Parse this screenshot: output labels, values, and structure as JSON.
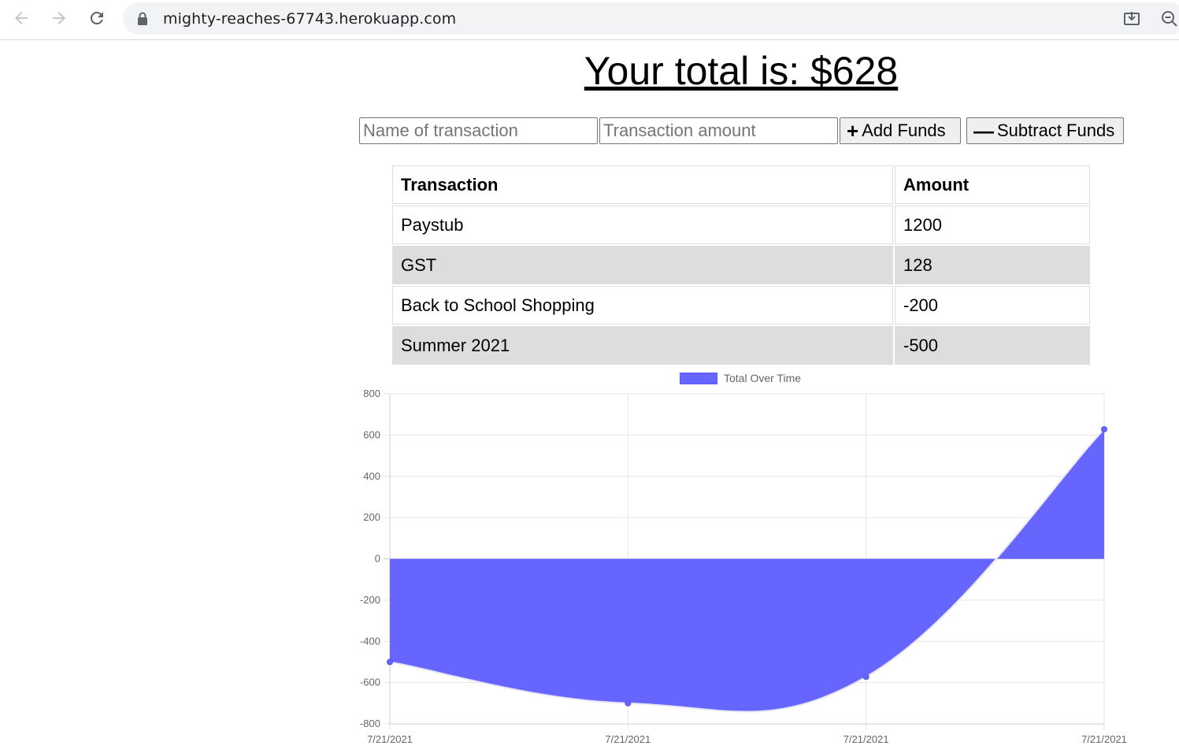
{
  "browser": {
    "url": "mighty-reaches-67743.herokuapp.com"
  },
  "header": {
    "total_text": "Your total is: $628"
  },
  "form": {
    "name_placeholder": "Name of transaction",
    "amount_placeholder": "Transaction amount",
    "add_label": "Add Funds",
    "subtract_label": "Subtract Funds"
  },
  "table": {
    "headers": [
      "Transaction",
      "Amount"
    ],
    "rows": [
      {
        "name": "Paystub",
        "amount": "1200"
      },
      {
        "name": "GST",
        "amount": "128"
      },
      {
        "name": "Back to School Shopping",
        "amount": "-200"
      },
      {
        "name": "Summer 2021",
        "amount": "-500"
      }
    ]
  },
  "chart_data": {
    "type": "area",
    "title": "",
    "x": [
      "7/21/2021",
      "7/21/2021",
      "7/21/2021",
      "7/21/2021"
    ],
    "series": [
      {
        "name": "Total Over Time",
        "values": [
          -500,
          -700,
          -572,
          628
        ],
        "color": "#6666ff"
      }
    ],
    "ylim": [
      -800,
      800
    ],
    "yticks": [
      800,
      600,
      400,
      200,
      0,
      -200,
      -400,
      -600,
      -800
    ],
    "grid": true,
    "legend": "top"
  }
}
